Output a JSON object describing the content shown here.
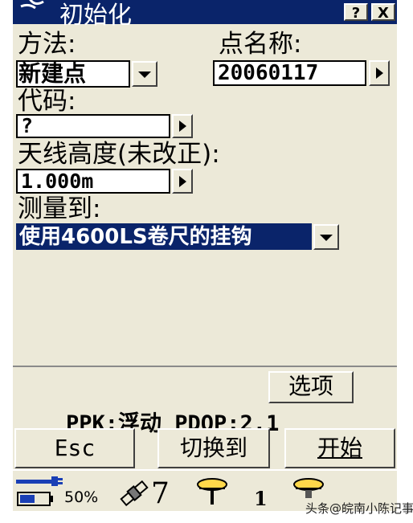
{
  "window": {
    "title": "初始化",
    "help_label": "?",
    "close_label": "X"
  },
  "form": {
    "method": {
      "label": "方法:",
      "value": "新建点"
    },
    "point_name": {
      "label": "点名称:",
      "value": "20060117"
    },
    "code": {
      "label": "代码:",
      "value": "?"
    },
    "antenna_height": {
      "label": "天线高度(未改正):",
      "value": "1.000m"
    },
    "measured_to": {
      "label": "测量到:",
      "value": "使用4600LS卷尺的挂钩"
    }
  },
  "options_button": "选项",
  "status": {
    "text": "PPK:浮动 PDOP:2.1"
  },
  "buttons": {
    "esc": "Esc",
    "switch_to": "切换到",
    "start": "开始"
  },
  "taskbar": {
    "battery": "50%",
    "satellites": "7",
    "radio_count": "1"
  },
  "watermark": "头条@皖南小陈记事"
}
